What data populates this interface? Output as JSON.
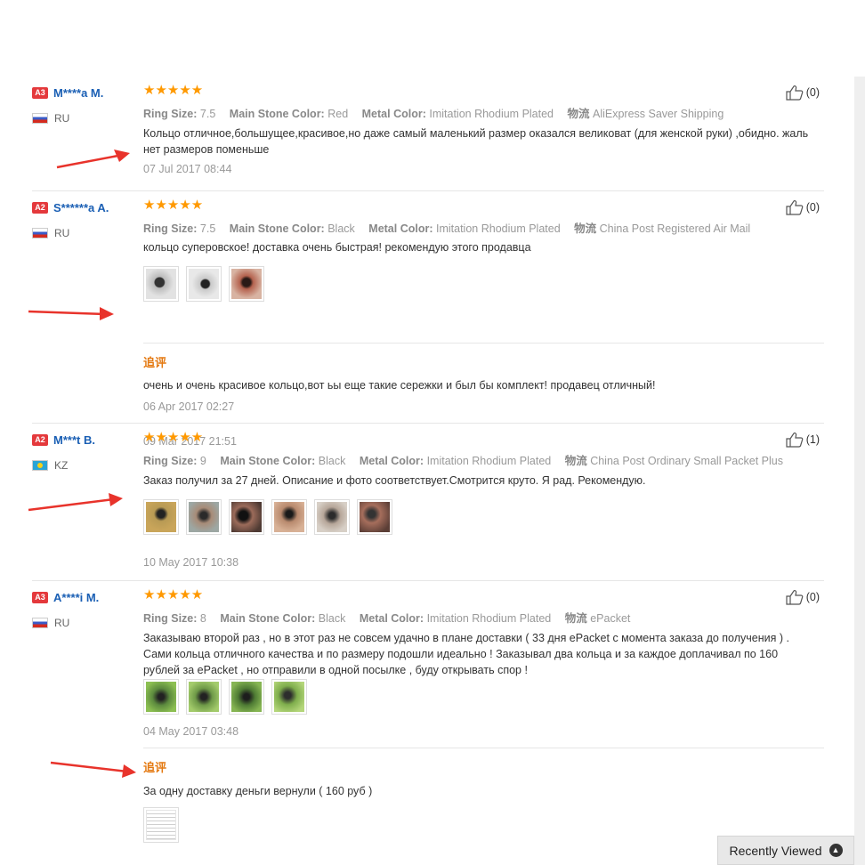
{
  "reviews": [
    {
      "level": "A3",
      "name": "M****a M.",
      "country": "RU",
      "stars": "★★★★★",
      "ring_size_label": "Ring Size:",
      "ring_size": "7.5",
      "stone_label": "Main Stone Color:",
      "stone": "Red",
      "metal_label": "Metal Color:",
      "metal": "Imitation Rhodium Plated",
      "ship_label": "物流",
      "ship": "AliExpress Saver Shipping",
      "text": "Кольцо отличное,большущее,красивое,но даже самый маленький размер оказался великоват (для женской руки) ,обидно. жаль нет размеров поменьше",
      "date": "07 Jul 2017 08:44",
      "helpful": "(0)"
    },
    {
      "level": "A2",
      "name": "S******a A.",
      "country": "RU",
      "stars": "★★★★★",
      "ring_size_label": "Ring Size:",
      "ring_size": "7.5",
      "stone_label": "Main Stone Color:",
      "stone": "Black",
      "metal_label": "Metal Color:",
      "metal": "Imitation Rhodium Plated",
      "ship_label": "物流",
      "ship": "China Post Registered Air Mail",
      "text": "кольцо суперовское! доставка очень быстрая! рекомендую этого продавца",
      "date": "09 Mar 2017 21:51",
      "followup_label": "追评",
      "followup_text": "очень и очень красивое кольцо,вот ьы еще такие сережки и был бы комплект! продавец отличный!",
      "followup_date": "06 Apr 2017 02:27",
      "helpful": "(0)"
    },
    {
      "level": "A2",
      "name": "M***t B.",
      "country": "KZ",
      "stars": "★★★★★",
      "ring_size_label": "Ring Size:",
      "ring_size": "9",
      "stone_label": "Main Stone Color:",
      "stone": "Black",
      "metal_label": "Metal Color:",
      "metal": "Imitation Rhodium Plated",
      "ship_label": "物流",
      "ship": "China Post Ordinary Small Packet Plus",
      "text": "Заказ получил за 27 дней. Описание и фото соответствует.Смотрится круто. Я рад. Рекомендую.",
      "date": "10 May 2017 10:38",
      "helpful": "(1)"
    },
    {
      "level": "A3",
      "name": "A****i M.",
      "country": "RU",
      "stars": "★★★★★",
      "ring_size_label": "Ring Size:",
      "ring_size": "8",
      "stone_label": "Main Stone Color:",
      "stone": "Black",
      "metal_label": "Metal Color:",
      "metal": "Imitation Rhodium Plated",
      "ship_label": "物流",
      "ship": "ePacket",
      "text": "Заказываю второй раз , но в этот раз не совсем удачно в плане доставки ( 33 дня ePacket с момента заказа до получения ) . Сами кольца отличного качества и по размеру подошли идеально ! Заказывал два кольца и за каждое доплачивал по 160 рублей за ePacket , но отправили в одной посылке , буду открывать спор !",
      "date": "04 May 2017 03:48",
      "followup_label": "追评",
      "followup_text": "За одну доставку деньги вернули ( 160 руб )",
      "helpful": "(0)"
    }
  ],
  "recent": {
    "label": "Recently Viewed",
    "icon": "chevron-up-icon"
  },
  "colors": {
    "star": "#ff9900",
    "name": "#1a5fb4",
    "followup": "#e47911",
    "arrow": "#e8332b"
  }
}
